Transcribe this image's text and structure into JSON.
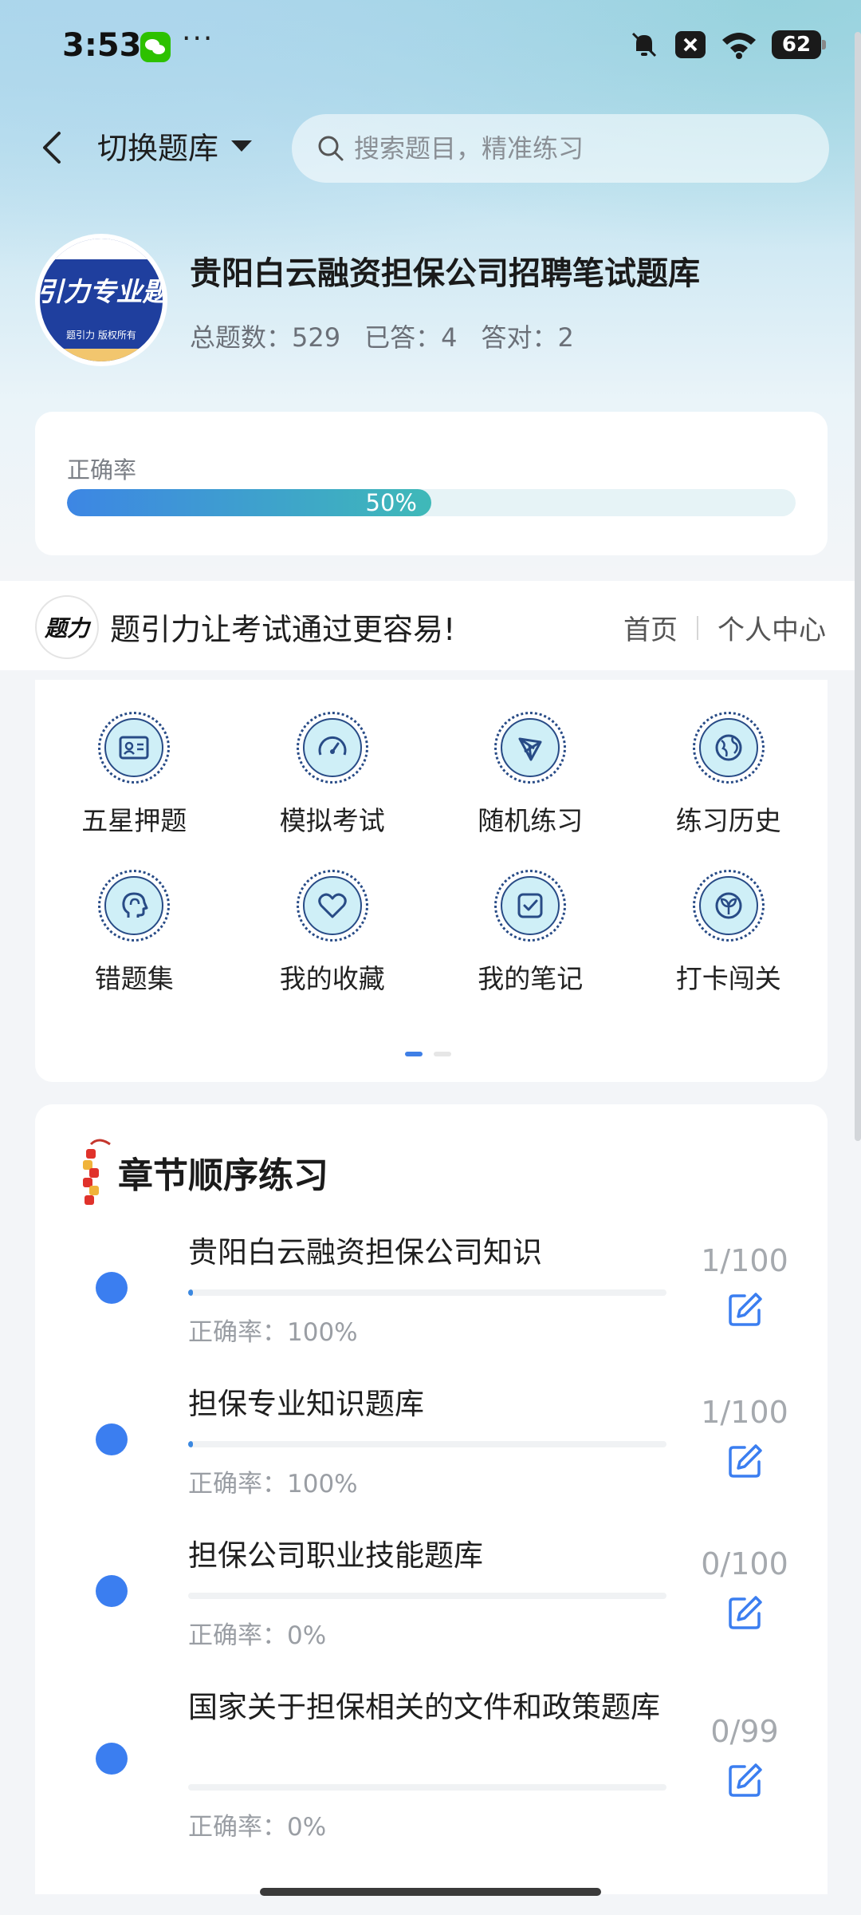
{
  "status_bar": {
    "time": "3:53",
    "more": "···",
    "battery": "62"
  },
  "header": {
    "back_label": "‹",
    "switch_label": "切换题库",
    "search_placeholder": "搜索题目，精准练习"
  },
  "bank": {
    "logo_text": "引力专业题",
    "logo_sub": "题引力 版权所有",
    "title": "贵阳白云融资担保公司招聘笔试题库",
    "total": "总题数：529",
    "answered": "已答：4",
    "correct": "答对：2"
  },
  "accuracy": {
    "label": "正确率",
    "value_text": "50%",
    "value": 0.5
  },
  "slogan": {
    "logo_text": "题力",
    "text": "题引力让考试通过更容易!",
    "link_home": "首页",
    "link_profile": "个人中心"
  },
  "menu": {
    "items": [
      {
        "label": "五星押题",
        "icon": "id-card-icon"
      },
      {
        "label": "模拟考试",
        "icon": "speedometer-icon"
      },
      {
        "label": "随机练习",
        "icon": "network-icon"
      },
      {
        "label": "练习历史",
        "icon": "globe-icon"
      },
      {
        "label": "错题集",
        "icon": "head-icon"
      },
      {
        "label": "我的收藏",
        "icon": "heart-icon"
      },
      {
        "label": "我的笔记",
        "icon": "check-note-icon"
      },
      {
        "label": "打卡闯关",
        "icon": "sprout-icon"
      }
    ],
    "page": 1,
    "pages": 2
  },
  "chapters": {
    "title": "章节顺序练习",
    "items": [
      {
        "name": "贵阳白云融资担保公司知识",
        "accuracy": "正确率：100%",
        "count": "1/100",
        "progress": 0.01
      },
      {
        "name": "担保专业知识题库",
        "accuracy": "正确率：100%",
        "count": "1/100",
        "progress": 0.01
      },
      {
        "name": "担保公司职业技能题库",
        "accuracy": "正确率：0%",
        "count": "0/100",
        "progress": 0
      },
      {
        "name": "国家关于担保相关的文件和政策题库",
        "accuracy": "正确率：0%",
        "count": "0/99",
        "progress": 0
      }
    ]
  },
  "colors": {
    "accent": "#3b7ef0",
    "icon_stroke": "#284b86",
    "icon_fill": "#cfeff7",
    "progress_start": "#3d86e4",
    "progress_end": "#3fb9b8"
  }
}
